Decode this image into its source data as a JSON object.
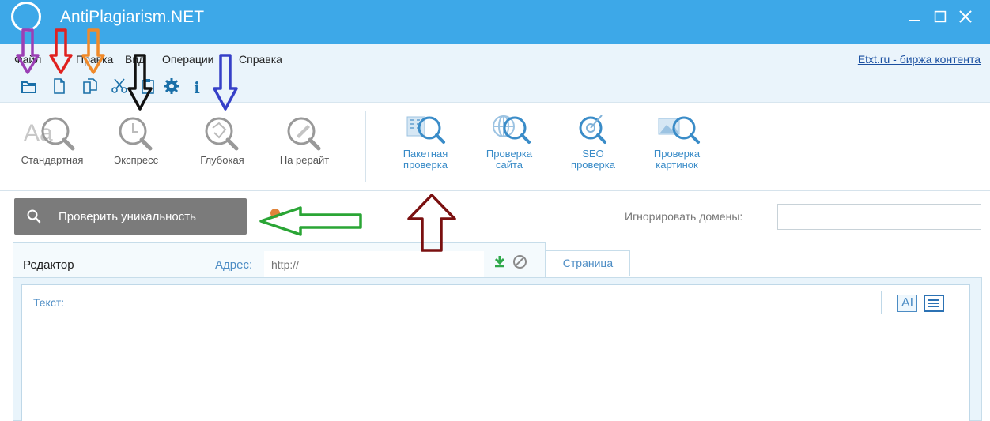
{
  "window": {
    "title": "AntiPlagiarism.NET"
  },
  "menu": {
    "items": [
      "Файл",
      "Правка",
      "Вид",
      "Операции",
      "Справка"
    ],
    "etxt_link": "Etxt.ru - биржа контента"
  },
  "toolbar": {
    "icons": [
      "open-folder-icon",
      "new-document-icon",
      "copy-document-icon",
      "cut-icon",
      "paste-icon",
      "settings-gear-icon",
      "info-icon"
    ]
  },
  "ribbon": {
    "checks": [
      {
        "label": "Стандартная",
        "icon": "standard-check-icon"
      },
      {
        "label": "Экспресс",
        "icon": "express-check-icon"
      },
      {
        "label": "Глубокая",
        "icon": "deep-check-icon"
      },
      {
        "label": "На рерайт",
        "icon": "rewrite-check-icon"
      }
    ],
    "tools": [
      {
        "label_line1": "Пакетная",
        "label_line2": "проверка",
        "icon": "batch-check-icon"
      },
      {
        "label_line1": "Проверка",
        "label_line2": "сайта",
        "icon": "site-check-icon"
      },
      {
        "label_line1": "SEO",
        "label_line2": "проверка",
        "icon": "seo-check-icon"
      },
      {
        "label_line1": "Проверка",
        "label_line2": "картинок",
        "icon": "image-check-icon"
      }
    ]
  },
  "actions": {
    "check_button": "Проверить уникальность",
    "ignore_domains_label": "Игнорировать домены:",
    "ignore_domains_value": ""
  },
  "editor": {
    "tab_editor": "Редактор",
    "address_label": "Адрес:",
    "address_placeholder": "http://",
    "tab_page": "Страница",
    "text_label": "Текст:",
    "font_icon_text": "AI"
  },
  "colors": {
    "titlebar": "#3da8e8",
    "menubar": "#eaf4fb",
    "check_button": "#7b7b7b",
    "accent_blue": "#4c8cc4",
    "annotation_arrows": [
      "#9b3fb5",
      "#e0211f",
      "#f08a2a",
      "#111111",
      "#3640c8",
      "#2aa535",
      "#7a1010"
    ]
  }
}
